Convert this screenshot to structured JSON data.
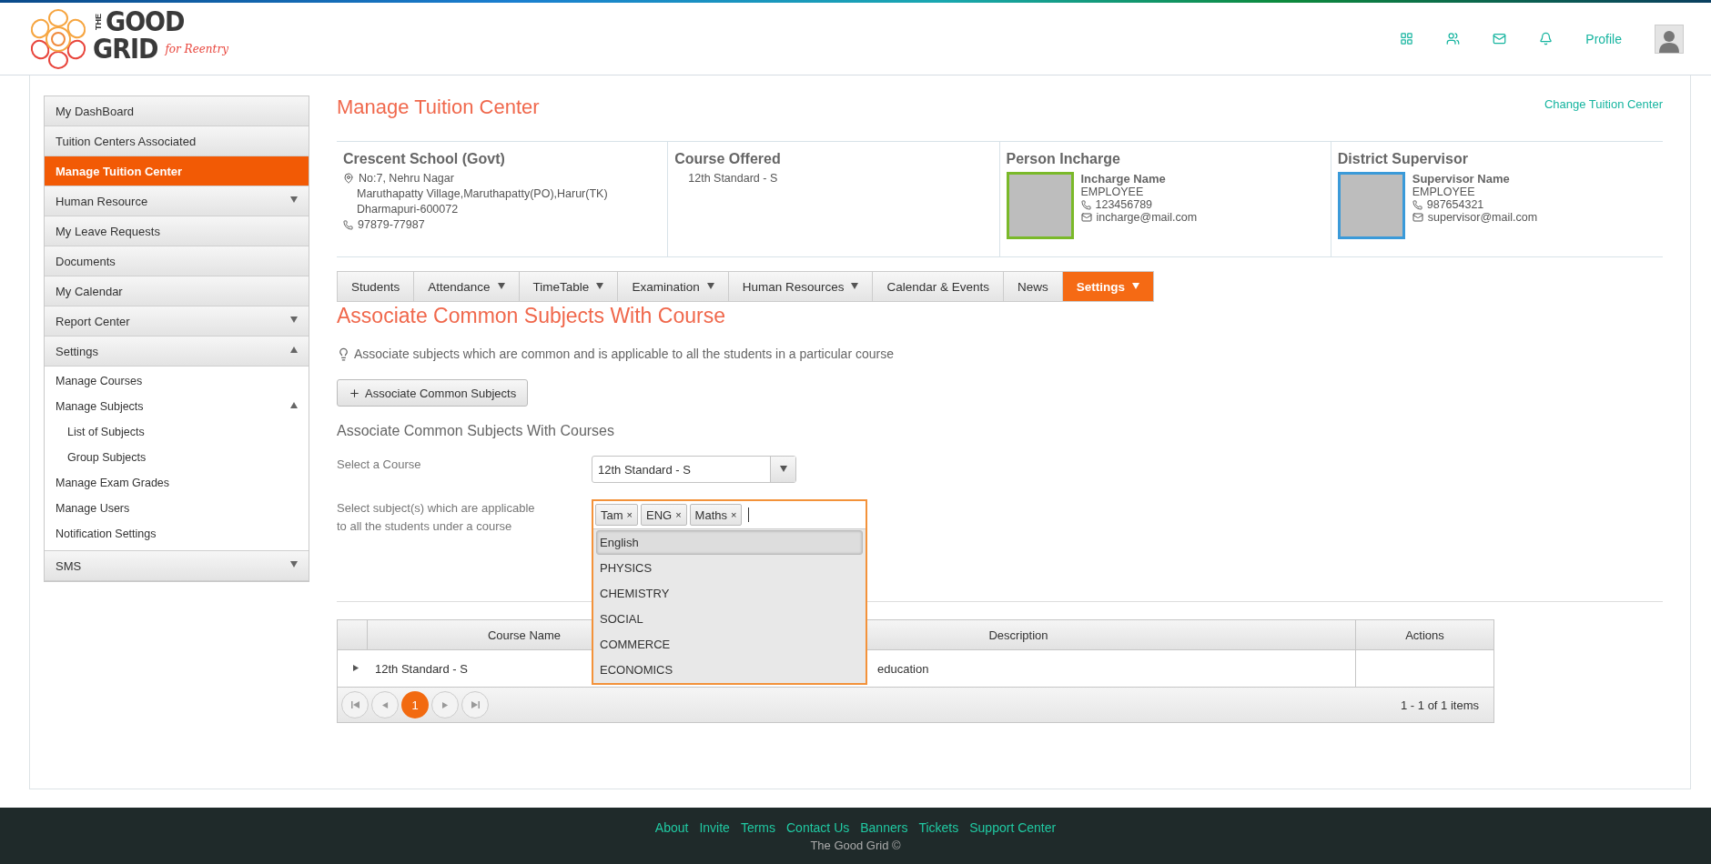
{
  "header": {
    "logo": {
      "the": "THE",
      "good": "GOOD",
      "grid": "GRID",
      "tagline": "for Reentry"
    },
    "profile_link": "Profile"
  },
  "sidebar": {
    "items": [
      {
        "label": "My DashBoard",
        "selected": false
      },
      {
        "label": "Tuition Centers Associated",
        "selected": false
      },
      {
        "label": "Manage Tuition Center",
        "selected": true
      },
      {
        "label": "Human Resource",
        "selected": false,
        "expanded": false
      },
      {
        "label": "My Leave Requests",
        "selected": false
      },
      {
        "label": "Documents",
        "selected": false
      },
      {
        "label": "My Calendar",
        "selected": false
      },
      {
        "label": "Report Center",
        "selected": false,
        "expanded": false
      },
      {
        "label": "Settings",
        "selected": false,
        "expanded": true,
        "children": [
          {
            "label": "Manage Courses"
          },
          {
            "label": "Manage Subjects",
            "expanded": true,
            "children": [
              {
                "label": "List of Subjects"
              },
              {
                "label": "Group Subjects"
              }
            ]
          },
          {
            "label": "Manage Exam Grades"
          },
          {
            "label": "Manage Users"
          },
          {
            "label": "Notification Settings"
          }
        ]
      },
      {
        "label": "SMS",
        "selected": false,
        "expanded": false
      }
    ]
  },
  "page": {
    "title": "Manage Tuition Center",
    "change_link": "Change Tuition Center"
  },
  "info": {
    "school": {
      "name": "Crescent School (Govt)",
      "address": [
        "No:7, Nehru Nagar",
        "Maruthapatty Village,Maruthapatty(PO),Harur(TK)",
        "Dharmapuri-600072"
      ],
      "phone": "97879-77987"
    },
    "course": {
      "heading": "Course Offered",
      "value": "12th Standard - S"
    },
    "people": [
      {
        "heading": "Person Incharge",
        "name": "Incharge Name",
        "role": "EMPLOYEE",
        "phone": "123456789",
        "email": "incharge@mail.com",
        "color": "#7ab929"
      },
      {
        "heading": "District Supervisor",
        "name": "Supervisor Name",
        "role": "EMPLOYEE",
        "phone": "987654321",
        "email": "supervisor@mail.com",
        "color": "#3a9ad9"
      }
    ]
  },
  "tabs": [
    {
      "label": "Students",
      "selected": false,
      "dropdown": false
    },
    {
      "label": "Attendance",
      "selected": false,
      "dropdown": true
    },
    {
      "label": "TimeTable",
      "selected": false,
      "dropdown": true
    },
    {
      "label": "Examination",
      "selected": false,
      "dropdown": true
    },
    {
      "label": "Human Resources",
      "selected": false,
      "dropdown": true
    },
    {
      "label": "Calendar & Events",
      "selected": false,
      "dropdown": false
    },
    {
      "label": "News",
      "selected": false,
      "dropdown": false
    },
    {
      "label": "Settings",
      "selected": true,
      "dropdown": true
    }
  ],
  "section": {
    "title": "Associate Common Subjects With Course",
    "hint": "Associate subjects which are common and is applicable to all the students in a particular course",
    "add_button": "Associate Common Subjects",
    "subtitle": "Associate Common Subjects With Courses"
  },
  "form": {
    "course_label": "Select a Course",
    "course_value": "12th Standard - S",
    "subjects_label": [
      "Select subject(s) which are applicable",
      "to all the students under a course"
    ],
    "tags": [
      {
        "label": "Tam",
        "remove": "×"
      },
      {
        "label": "ENG",
        "remove": "×"
      },
      {
        "label": "Maths",
        "remove": "×"
      }
    ],
    "options": [
      {
        "label": "English",
        "selected": true
      },
      {
        "label": "PHYSICS",
        "selected": false
      },
      {
        "label": "CHEMISTRY",
        "selected": false
      },
      {
        "label": "SOCIAL",
        "selected": false
      },
      {
        "label": "COMMERCE",
        "selected": false
      },
      {
        "label": "ECONOMICS",
        "selected": false
      }
    ]
  },
  "table": {
    "columns": [
      "Course Name",
      "Description",
      "Actions"
    ],
    "rows": [
      {
        "course_name": "12th Standard - S",
        "description": "education"
      }
    ],
    "pages": [
      {
        "label": "1",
        "selected": true
      }
    ],
    "summary": "1 - 1 of 1 items"
  },
  "footer": {
    "links": [
      "About",
      "Invite",
      "Terms",
      "Contact Us",
      "Banners",
      "Tickets",
      "Support Center"
    ],
    "copyright": "The Good Grid ©"
  }
}
